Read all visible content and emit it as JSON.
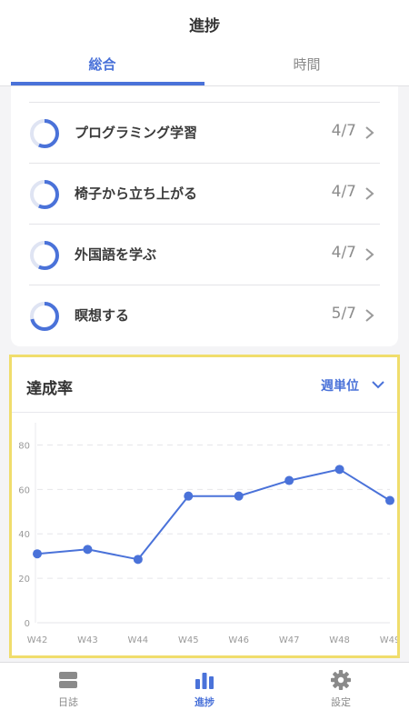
{
  "header": {
    "title": "進捗"
  },
  "tabs": [
    {
      "label": "総合",
      "active": true
    },
    {
      "label": "時間",
      "active": false
    }
  ],
  "habits": [
    {
      "name": "プログラミング学習",
      "count": "4/7",
      "progress": 0.571
    },
    {
      "name": "椅子から立ち上がる",
      "count": "4/7",
      "progress": 0.571
    },
    {
      "name": "外国語を学ぶ",
      "count": "4/7",
      "progress": 0.571
    },
    {
      "name": "瞑想する",
      "count": "5/7",
      "progress": 0.714
    }
  ],
  "chart_card": {
    "title": "達成率",
    "period_label": "週単位"
  },
  "chart_data": {
    "type": "line",
    "title": "達成率",
    "categories": [
      "W42",
      "W43",
      "W44",
      "W45",
      "W46",
      "W47",
      "W48",
      "W49"
    ],
    "values": [
      31,
      33,
      28.5,
      57,
      57,
      64,
      69,
      55
    ],
    "ylim": [
      0,
      90
    ],
    "yticks": [
      "0",
      "20",
      "40",
      "60",
      "80"
    ],
    "grid": true,
    "color": "#4a72d9"
  },
  "tabbar": [
    {
      "label": "日誌",
      "icon": "journal-icon",
      "active": false
    },
    {
      "label": "進捗",
      "icon": "bar-chart-icon",
      "active": true
    },
    {
      "label": "設定",
      "icon": "gear-icon",
      "active": false
    }
  ],
  "colors": {
    "accent": "#4a72d9",
    "ring_track": "#dfe4f3",
    "highlight": "#f0dd6c"
  }
}
